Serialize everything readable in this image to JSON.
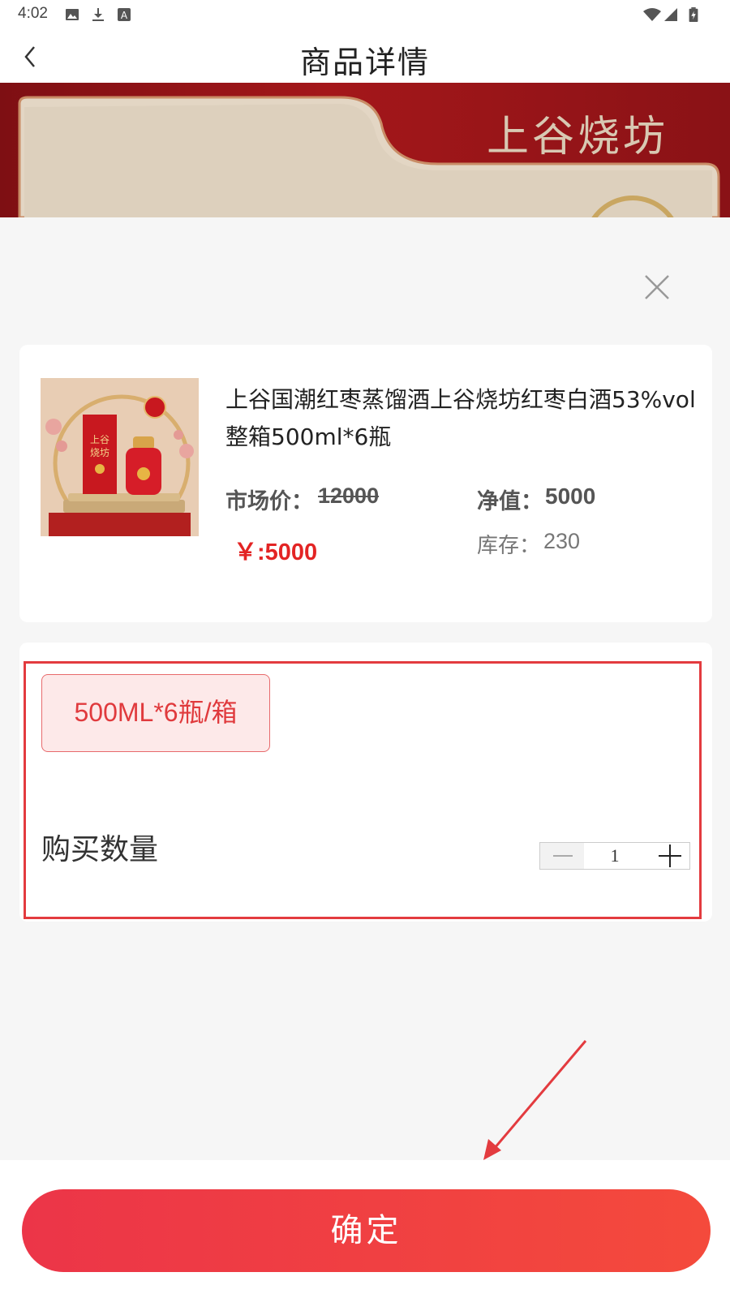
{
  "status_bar": {
    "time": "4:02",
    "icons": [
      "image-icon",
      "download-icon",
      "keyboard-icon",
      "wifi-icon",
      "signal-icon",
      "battery-icon"
    ]
  },
  "nav": {
    "back_icon": "chevron-left-icon",
    "title": "商品详情"
  },
  "banner": {
    "brand_text": "上谷烧坊"
  },
  "product": {
    "title": "上谷国潮红枣蒸馏酒上谷烧坊红枣白酒53%vol整箱500ml*6瓶",
    "market_price_label": "市场价：",
    "market_price_value": "12000",
    "net_value_label": "净值：",
    "net_value_value": "5000",
    "price": "￥:5000",
    "stock_label": "库存：",
    "stock_value": "230",
    "image_brand_text": "上谷烧坊"
  },
  "spec": {
    "option_label": "500ML*6瓶/箱",
    "quantity_label": "购买数量",
    "quantity_value": "1"
  },
  "actions": {
    "confirm_label": "确定",
    "close_icon": "close-icon"
  },
  "colors": {
    "accent": "#e32424",
    "banner": "#8a1216",
    "button_start": "#ec3548",
    "button_end": "#f44a3c"
  }
}
